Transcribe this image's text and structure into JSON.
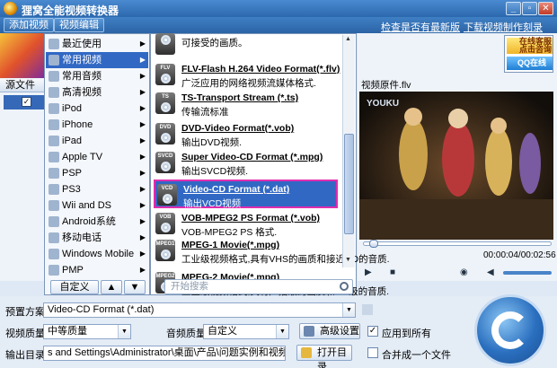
{
  "app": {
    "title": "狸窝全能视频转换器"
  },
  "toolbar": {
    "add_video": "添加视频",
    "edit_video": "视频编辑"
  },
  "top_links": [
    "检查是否有最新版",
    "下载视频",
    "制作刻录DVD"
  ],
  "file_list": {
    "column_header": "源文件"
  },
  "category_menu": {
    "items": [
      {
        "label": "最近使用",
        "icon": "clock-icon"
      },
      {
        "label": "常用视频",
        "icon": "film-icon",
        "selected": true
      },
      {
        "label": "常用音频",
        "icon": "music-icon"
      },
      {
        "label": "高清视频",
        "icon": "hd-icon"
      },
      {
        "label": "iPod",
        "icon": "ipod-icon"
      },
      {
        "label": "iPhone",
        "icon": "iphone-icon"
      },
      {
        "label": "iPad",
        "icon": "ipad-icon"
      },
      {
        "label": "Apple TV",
        "icon": "apple-tv-icon"
      },
      {
        "label": "PSP",
        "icon": "psp-icon"
      },
      {
        "label": "PS3",
        "icon": "ps3-icon"
      },
      {
        "label": "Wii and DS",
        "icon": "wii-icon"
      },
      {
        "label": "Android系统",
        "icon": "android-icon"
      },
      {
        "label": "移动电话",
        "icon": "phone-icon"
      },
      {
        "label": "Windows Mobile",
        "icon": "windows-icon"
      },
      {
        "label": "PMP",
        "icon": "pmp-icon"
      }
    ],
    "customize_label": "自定义",
    "search_placeholder": "开始搜索"
  },
  "format_menu": {
    "items": [
      {
        "name": "",
        "desc": "可接受的画质。",
        "icon_text": ""
      },
      {
        "name": "FLV-Flash H.264 Video Format(*.flv)",
        "desc": "广泛应用的网络视频流媒体格式.",
        "icon_text": "FLV"
      },
      {
        "name": "TS-Transport Stream (*.ts)",
        "desc": "传输流标准",
        "icon_text": "TS"
      },
      {
        "name": "DVD-Video Format(*.vob)",
        "desc": "输出DVD视频.",
        "icon_text": "DVD"
      },
      {
        "name": "Super Video-CD Format (*.mpg)",
        "desc": "输出SVCD视频.",
        "icon_text": "SVCD"
      },
      {
        "name": "Video-CD Format (*.dat)",
        "desc": "输出VCD视频",
        "icon_text": "VCD",
        "selected": true
      },
      {
        "name": "VOB-MPEG2 PS Format (*.vob)",
        "desc": "VOB-MPEG2 PS 格式.",
        "icon_text": "VOB"
      },
      {
        "name": "MPEG-1 Movie(*.mpg)",
        "desc": "工业级视频格式,具有VHS的画质和接近CD的音质.",
        "icon_text": "MPEG1"
      },
      {
        "name": "MPEG-2 Movie(*.mpg)",
        "desc": "工业级视频格式,具有广播级的画质和CD级的音质.",
        "icon_text": "MPEG2"
      }
    ]
  },
  "ad": {
    "consult": "在线客服 点击咨询",
    "qq": "QQ在线"
  },
  "preview": {
    "label": "视频原件.flv",
    "time": "00:00:04/00:02:56",
    "progress": 0.03
  },
  "settings": {
    "preset_label": "预置方案:",
    "preset_value": "Video-CD Format (*.dat)",
    "video_quality_label": "视频质量:",
    "video_quality_value": "中等质量",
    "audio_quality_label": "音频质量:",
    "audio_quality_value": "自定义",
    "advanced_button": "高级设置",
    "apply_all_label": "应用到所有",
    "apply_all_checked": true,
    "output_label": "输出目录:",
    "output_path": "s and Settings\\Administrator\\桌面\\产品\\问题实例和视频原件\\转换",
    "open_dir_button": "打开目录",
    "merge_label": "合并成一个文件",
    "merge_checked": false
  },
  "colors": {
    "accent": "#3168c4",
    "highlight_border": "#e02cae",
    "titlebar": "#2c68ad"
  }
}
